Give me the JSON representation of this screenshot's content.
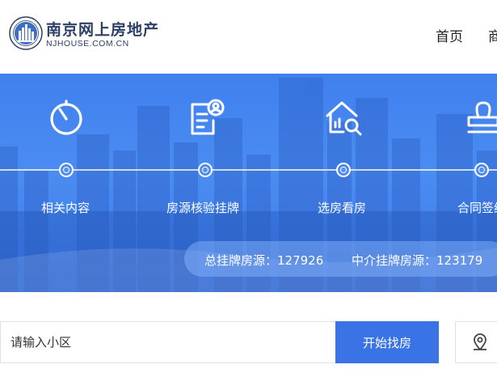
{
  "header": {
    "logo_cn": "南京网上房地产",
    "logo_en": "NJHOUSE.COM.CN",
    "nav": [
      {
        "label": "首页"
      },
      {
        "label": "商"
      }
    ]
  },
  "banner": {
    "steps": [
      {
        "label": "相关内容",
        "icon": "timer-icon"
      },
      {
        "label": "房源核验挂牌",
        "icon": "document-user-icon"
      },
      {
        "label": "选房看房",
        "icon": "house-search-icon"
      },
      {
        "label": "合同签约",
        "icon": "stamp-icon"
      }
    ],
    "stats": {
      "total": "总挂牌房源：127926",
      "agency": "中介挂牌房源：123179"
    }
  },
  "search": {
    "placeholder": "请输入小区",
    "button_label": "开始找房",
    "map_icon": "map-pin-icon"
  },
  "colors": {
    "banner_blue": "#4b8cf2",
    "button_blue": "#3a73e6",
    "logo_navy": "#2d3f66"
  }
}
